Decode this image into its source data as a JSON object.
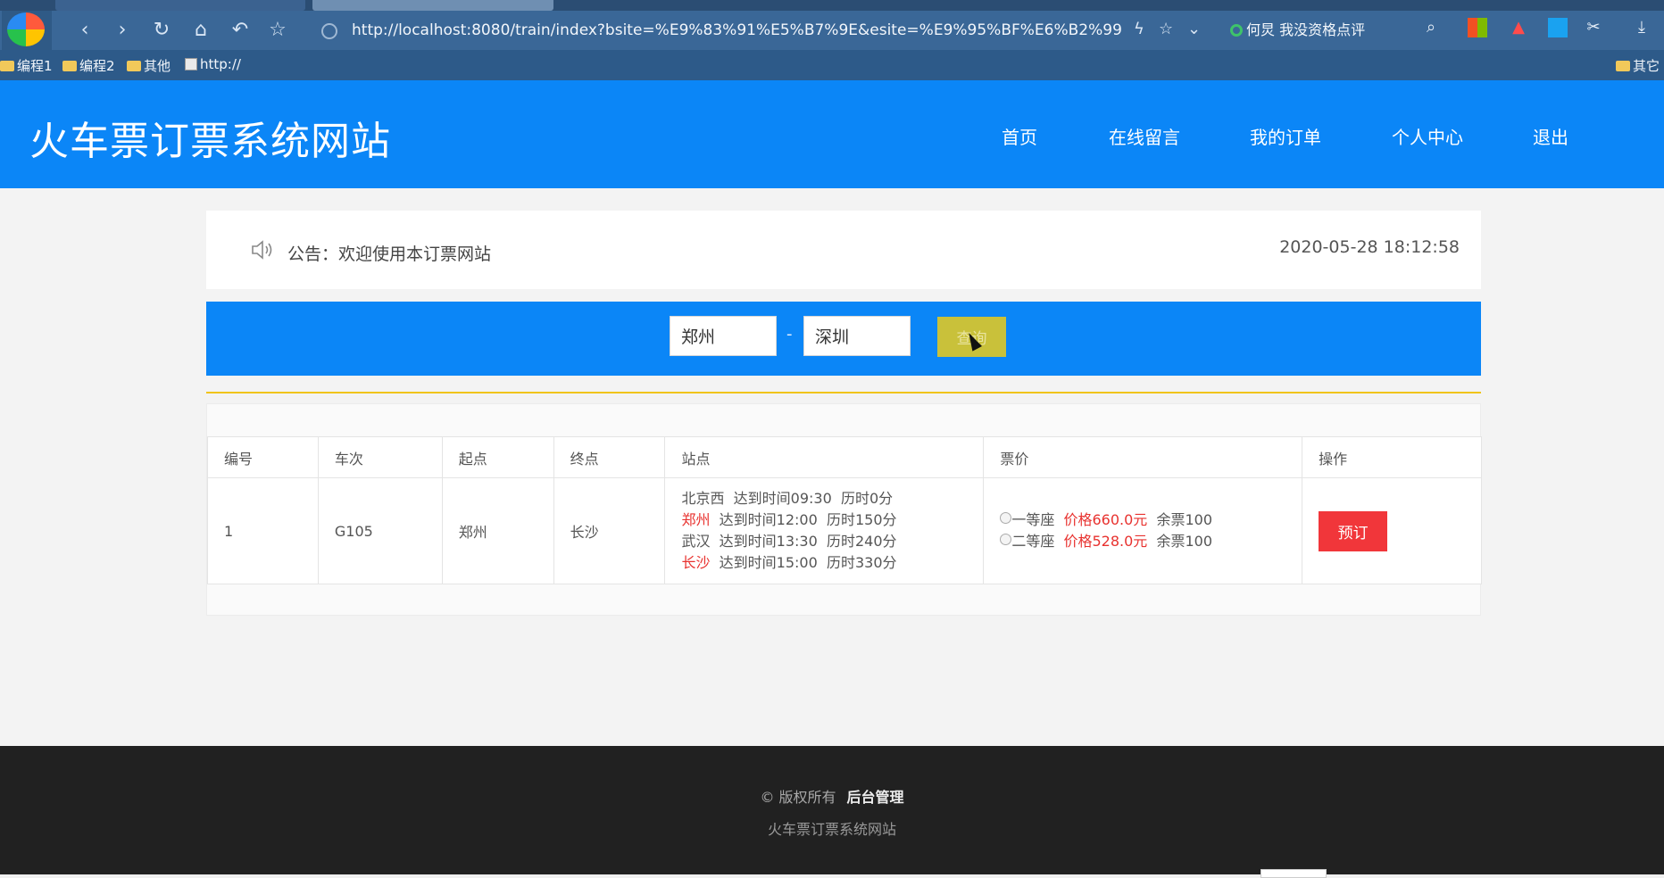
{
  "browser": {
    "url": "http://localhost:8080/train/index?bsite=%E9%83%91%E5%B7%9E&esite=%E9%95%BF%E6%B2%99",
    "promo": "何炅 我没资格点评",
    "bookmarks": [
      "编程1",
      "编程2",
      "其他",
      "http://",
      "其它"
    ]
  },
  "site": {
    "title": "火车票订票系统网站",
    "nav": [
      "首页",
      "在线留言",
      "我的订单",
      "个人中心",
      "退出"
    ]
  },
  "notice": {
    "text": "公告：欢迎使用本订票网站",
    "datetime": "2020-05-28 18:12:58"
  },
  "search": {
    "from": "郑州",
    "to": "深圳",
    "separator": "-",
    "button": "查询"
  },
  "table": {
    "headers": [
      "编号",
      "车次",
      "起点",
      "终点",
      "站点",
      "票价",
      "操作"
    ],
    "rows": [
      {
        "id": "1",
        "train": "G105",
        "start": "郑州",
        "end": "长沙",
        "stops": [
          {
            "station": "北京西",
            "arrive": "达到时间09:30",
            "duration": "历时0分",
            "highlight": false
          },
          {
            "station": "郑州",
            "arrive": "达到时间12:00",
            "duration": "历时150分",
            "highlight": true
          },
          {
            "station": "武汉",
            "arrive": "达到时间13:30",
            "duration": "历时240分",
            "highlight": false
          },
          {
            "station": "长沙",
            "arrive": "达到时间15:00",
            "duration": "历时330分",
            "highlight": true
          }
        ],
        "seats": [
          {
            "type": "一等座",
            "price": "价格660.0元",
            "remain": "余票100"
          },
          {
            "type": "二等座",
            "price": "价格528.0元",
            "remain": "余票100"
          }
        ],
        "action": "预订"
      }
    ]
  },
  "footer": {
    "copyright": "© 版权所有",
    "admin_link": "后台管理",
    "site_name": "火车票订票系统网站"
  },
  "colors": {
    "primary": "#0b86f7",
    "search_button": "#c9c13a",
    "book_button": "#f1363a",
    "highlight_red": "#e8322f",
    "footer_bg": "#212121"
  }
}
